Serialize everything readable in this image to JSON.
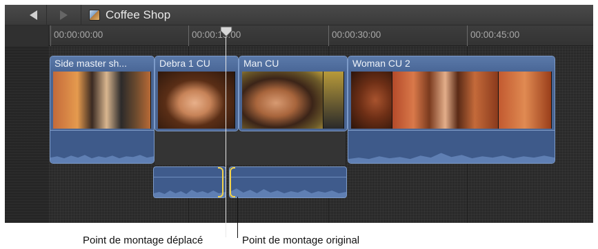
{
  "window": {
    "title": "Coffee Shop",
    "back_icon": "back-arrow-icon",
    "forward_icon": "forward-arrow-icon",
    "project_icon": "project-icon"
  },
  "ruler": {
    "timecodes": [
      "00:00:00:00",
      "00:00:15:00",
      "00:00:30:00",
      "00:00:45:00"
    ]
  },
  "clips": [
    {
      "title": "Side master sh..."
    },
    {
      "title": "Debra 1 CU"
    },
    {
      "title": "Man CU"
    },
    {
      "title": "Woman CU 2"
    }
  ],
  "callouts": {
    "moved": "Point de montage déplacé",
    "original": "Point de montage original"
  },
  "colors": {
    "clip_blue": "#4a6593",
    "edit_point_yellow": "#f4d34a",
    "playhead": "#e8e8e8"
  }
}
